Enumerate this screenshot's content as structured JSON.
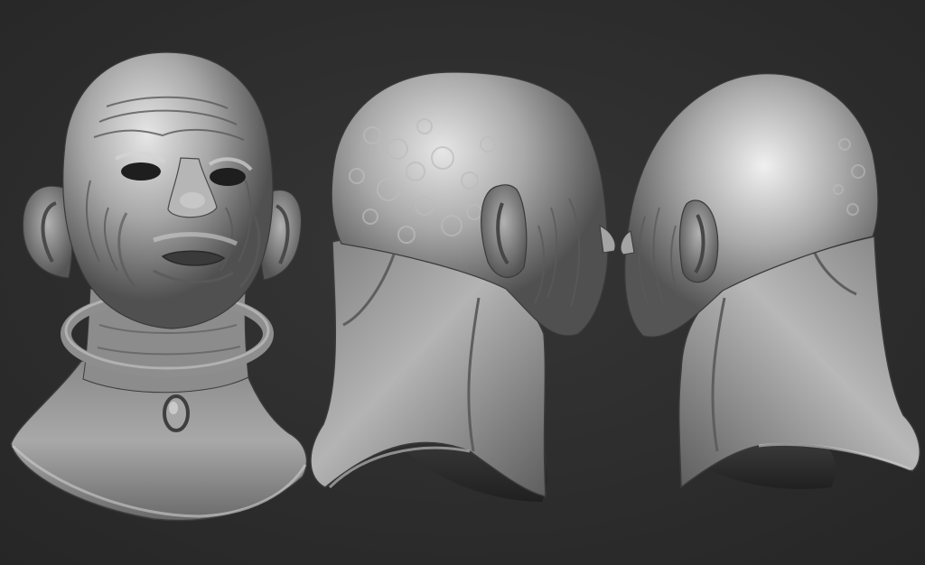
{
  "scene": {
    "background_color": "#303030",
    "clay_color": "#9a9a9a",
    "highlight_color": "#e4e4e4",
    "shadow_color": "#1c1c1c",
    "views": [
      {
        "name": "front-view",
        "subject": "head-with-high-collar"
      },
      {
        "name": "side-back-view-left",
        "subject": "head-with-high-collar"
      },
      {
        "name": "side-back-view-right",
        "subject": "head-with-high-collar"
      }
    ]
  }
}
